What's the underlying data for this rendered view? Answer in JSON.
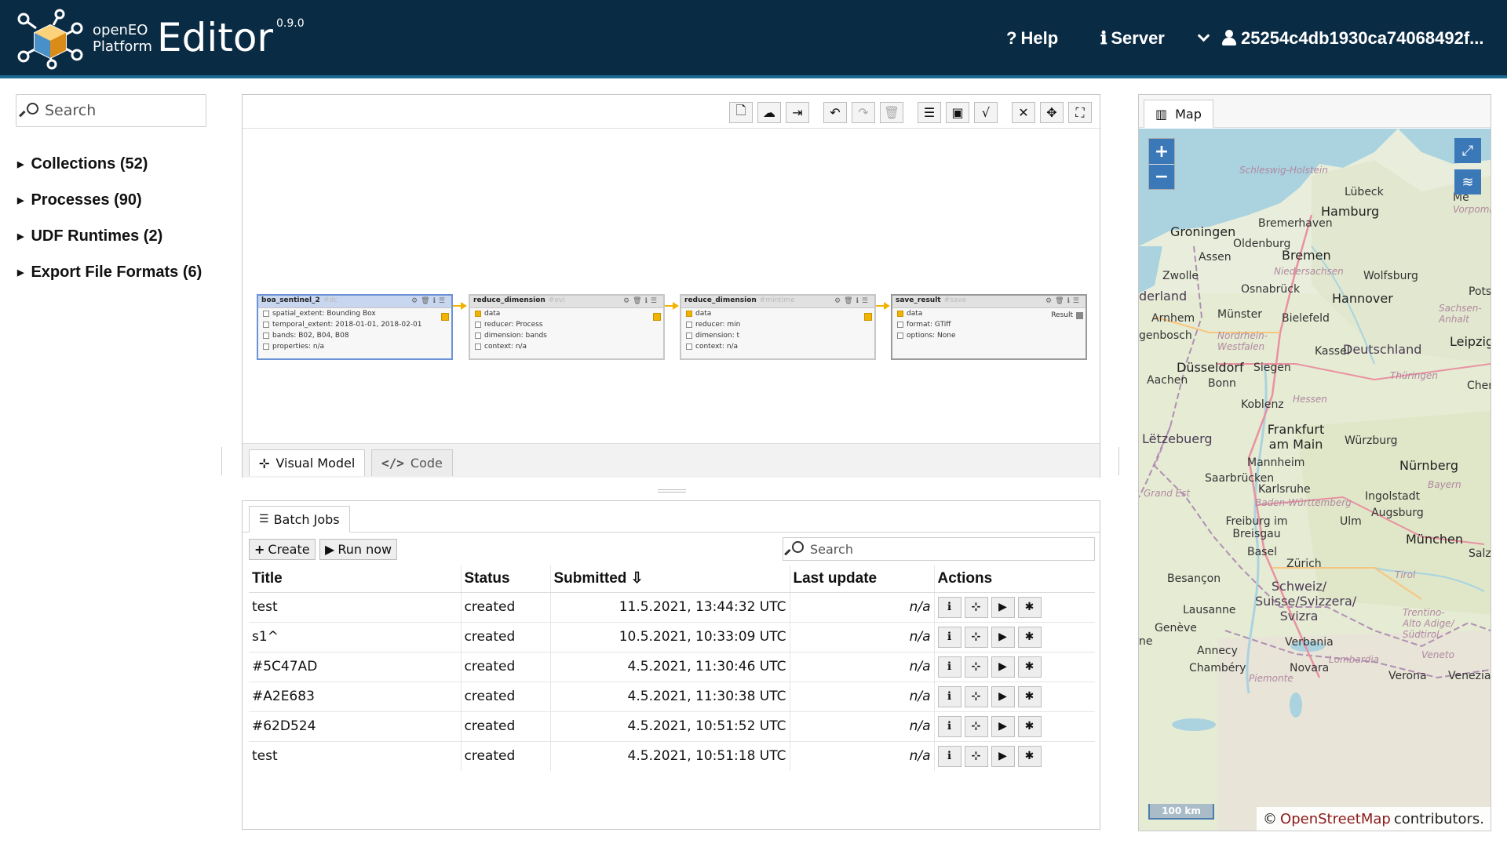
{
  "header": {
    "logo_line1": "openEO",
    "logo_line2": "Platform",
    "title": "Editor",
    "version": "0.9.0",
    "help_label": "Help",
    "server_label": "Server",
    "user_label": "25254c4db1930ca74068492f..."
  },
  "sidebar": {
    "search_placeholder": "Search",
    "items": [
      {
        "label": "Collections (52)"
      },
      {
        "label": "Processes (90)"
      },
      {
        "label": "UDF Runtimes (2)"
      },
      {
        "label": "Export File Formats (6)"
      }
    ]
  },
  "editor": {
    "toolbar_icons": [
      "new-file-icon",
      "cloud-upload-icon",
      "export-icon",
      "undo-icon",
      "redo-icon",
      "delete-icon",
      "settings-icon",
      "parameter-icon",
      "formula-icon",
      "compact-icon",
      "move-icon",
      "fullscreen-icon"
    ],
    "nodes": [
      {
        "name": "boa_sentinel_2",
        "id": "#dc",
        "rows": [
          "spatial_extent: Bounding Box",
          "temporal_extent: 2018-01-01, 2018-02-01",
          "bands: B02, B04, B08",
          "properties: n/a"
        ]
      },
      {
        "name": "reduce_dimension",
        "id": "#evi",
        "rows": [
          "data",
          "reducer: Process",
          "dimension: bands",
          "context: n/a"
        ]
      },
      {
        "name": "reduce_dimension",
        "id": "#mintime",
        "rows": [
          "data",
          "reducer: min",
          "dimension: t",
          "context: n/a"
        ]
      },
      {
        "name": "save_result",
        "id": "#save",
        "rows": [
          "data",
          "format: GTiff",
          "options: None"
        ],
        "result_label": "Result"
      }
    ],
    "tab_visual": "Visual Model",
    "tab_code": "Code"
  },
  "jobs": {
    "tab_label": "Batch Jobs",
    "create_label": "Create",
    "run_label": "Run now",
    "search_placeholder": "Search",
    "columns": {
      "title": "Title",
      "status": "Status",
      "submitted": "Submitted ⇩",
      "updated": "Last update",
      "actions": "Actions"
    },
    "rows": [
      {
        "title": "test",
        "status": "created",
        "submitted": "11.5.2021, 13:44:32 UTC",
        "updated": "n/a"
      },
      {
        "title": "s1^",
        "status": "created",
        "submitted": "10.5.2021, 10:33:09 UTC",
        "updated": "n/a"
      },
      {
        "title": "#5C47AD",
        "status": "created",
        "submitted": "4.5.2021, 11:30:46 UTC",
        "updated": "n/a"
      },
      {
        "title": "#A2E683",
        "status": "created",
        "submitted": "4.5.2021, 11:30:38 UTC",
        "updated": "n/a"
      },
      {
        "title": "#62D524",
        "status": "created",
        "submitted": "4.5.2021, 10:51:52 UTC",
        "updated": "n/a"
      },
      {
        "title": "test",
        "status": "created",
        "submitted": "4.5.2021, 10:51:18 UTC",
        "updated": "n/a"
      }
    ]
  },
  "map": {
    "tab_label": "Map",
    "zoom_in": "+",
    "zoom_out": "−",
    "scale_label": "100 km",
    "attribution_prefix": "©",
    "attribution_link": "OpenStreetMap",
    "attribution_suffix": "contributors.",
    "labels": {
      "schleswig_holstein": "Schleswig-Holstein",
      "lubeck": "Lübeck",
      "hamburg": "Hamburg",
      "bremerhaven": "Bremerhaven",
      "groningen": "Groningen",
      "oldenburg": "Oldenburg",
      "bremen": "Bremen",
      "assen": "Assen",
      "niedersachsen": "Niedersachsen",
      "zwolle": "Zwolle",
      "wolfsburg": "Wolfsburg",
      "nederland": "derland",
      "osnabruck": "Osnabrück",
      "hannover": "Hannover",
      "pots": "Pots",
      "sachsen_anhalt": "Sachsen-Anhalt",
      "arnhem": "Arnhem",
      "munster": "Münster",
      "bielefeld": "Bielefeld",
      "genbosch": "genbosch",
      "nrw": "Nordrhein-Westfalen",
      "leipzig": "Leipzig",
      "kassel": "Kassel",
      "deutschland": "Deutschland",
      "dusseldorf": "Düsseldorf",
      "siegen": "Siegen",
      "aachen": "Aachen",
      "bonn": "Bonn",
      "thuringen": "Thüringen",
      "chem": "Chem",
      "hessen": "Hessen",
      "koblenz": "Koblenz",
      "frankfurt": "Frankfurt am Main",
      "letzebuerg": "Lëtzebuerg",
      "wurzburg": "Würzburg",
      "mannheim": "Mannheim",
      "nurnberg": "Nürnberg",
      "saarbrucken": "Saarbrücken",
      "karlsruhe": "Karlsruhe",
      "bayern": "Bayern",
      "grand_est": "Grand Est",
      "ingolstadt": "Ingolstadt",
      "bw": "Baden-Württemberg",
      "augsburg": "Augsburg",
      "freiburg": "Freiburg im Breisgau",
      "ulm": "Ulm",
      "munchen": "München",
      "basel": "Basel",
      "zurich": "Zürich",
      "salzb": "Salzb",
      "besancon": "Besançon",
      "tirol": "Tirol",
      "schweiz": "Schweiz/ Suisse/Svizzera/ Svizra",
      "lausanne": "Lausanne",
      "trentino": "Trentino-Alto Adige/ Südtirol",
      "geneve": "Genève",
      "verbania": "Verbania",
      "annecy": "Annecy",
      "lombardia": "Lombardia",
      "veneto": "Veneto",
      "chambery": "Chambéry",
      "novara": "Novara",
      "verona": "Verona",
      "venezia": "Venezia",
      "piemonte": "Piemonte",
      "ne": "ne",
      "me": "Me",
      "vorpomm": "Vorpomme"
    }
  },
  "colors": {
    "header_bg": "#0a2b44",
    "accent_blue": "#3b78b8",
    "wire_yellow": "#f0b400",
    "attribution_link": "#8b1a1a"
  }
}
